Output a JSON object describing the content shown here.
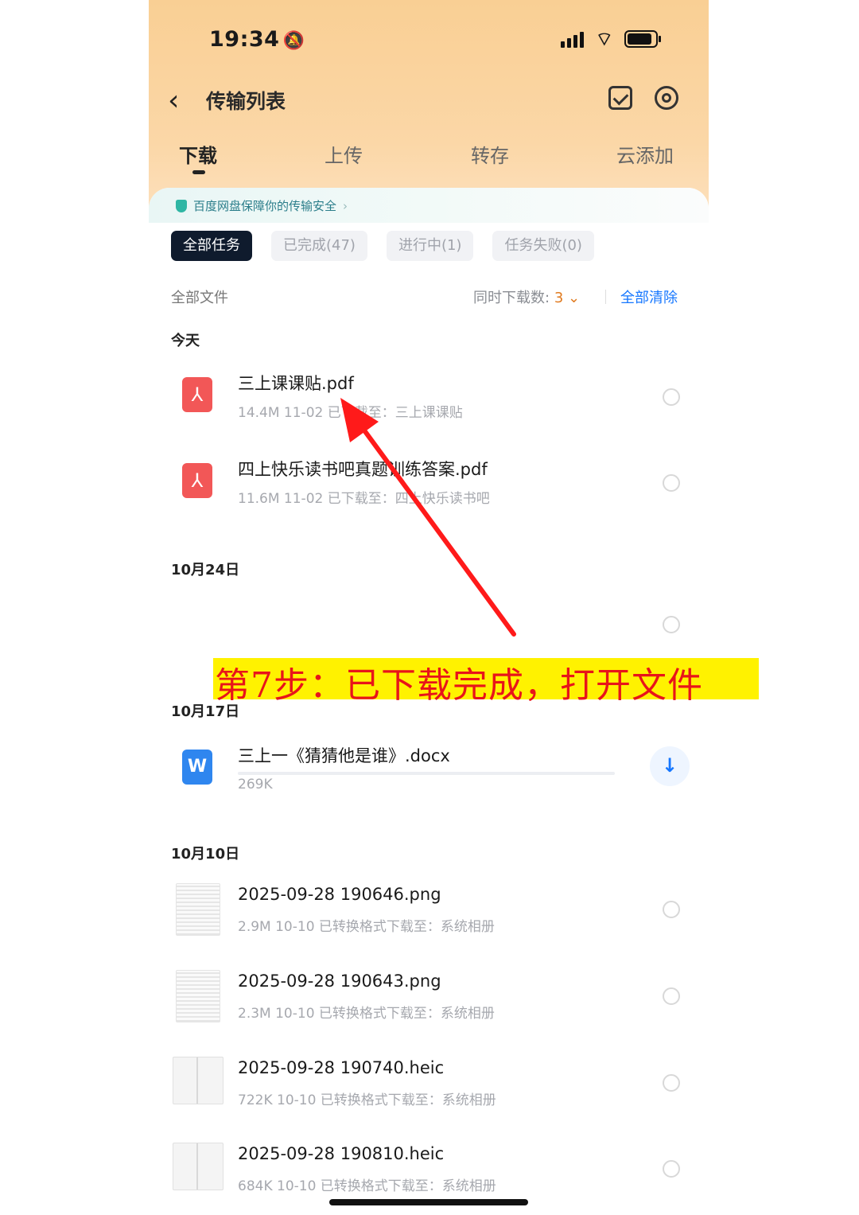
{
  "status": {
    "time": "19:34"
  },
  "nav": {
    "title": "传输列表"
  },
  "tabs": [
    "下载",
    "上传",
    "转存",
    "云添加"
  ],
  "security_notice": "百度网盘保障你的传输安全",
  "filters": [
    "全部任务",
    "已完成(47)",
    "进行中(1)",
    "任务失败(0)"
  ],
  "files_bar": {
    "all_files": "全部文件",
    "concurrent_label": "同时下载数:",
    "concurrent_value": "3",
    "clear_all": "全部清除"
  },
  "sections": [
    "今天",
    "10月24日",
    "10月17日",
    "10月10日"
  ],
  "files": [
    {
      "name": "三上课课贴.pdf",
      "meta": "14.4M  11-02  已下载至：三上课课贴"
    },
    {
      "name": "四上快乐读书吧真题训练答案.pdf",
      "meta": "11.6M  11-02  已下载至：四上快乐读书吧"
    },
    {
      "name": "三上一《猜猜他是谁》.docx",
      "meta": "269K"
    },
    {
      "name": "2025-09-28 190646.png",
      "meta": "2.9M  10-10  已转换格式下载至：系统相册"
    },
    {
      "name": "2025-09-28 190643.png",
      "meta": "2.3M  10-10  已转换格式下载至：系统相册"
    },
    {
      "name": "2025-09-28 190740.heic",
      "meta": "722K  10-10  已转换格式下载至：系统相册"
    },
    {
      "name": "2025-09-28 190810.heic",
      "meta": "684K  10-10  已转换格式下载至：系统相册"
    }
  ],
  "annotation": {
    "text": "第7步：已下载完成，打开文件",
    "color": "#e8141a",
    "highlight": "#fff200"
  },
  "colors": {
    "accent": "#1677ff",
    "header": "#f9cf94",
    "pdf": "#f25757",
    "word": "#2f86ef"
  }
}
